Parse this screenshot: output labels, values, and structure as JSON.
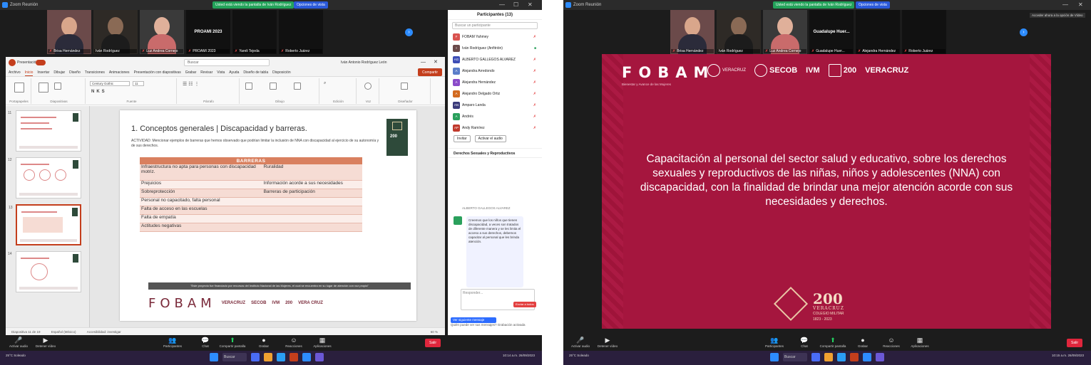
{
  "left": {
    "title": "Zoom Reunión",
    "share_banner": "Usted está viendo la pantalla de Iván Rodríguez",
    "share_options": "Opciones de vista",
    "participants": [
      {
        "name": "Brisa Hernández",
        "color": "#6b4a4a",
        "skin": "#d9a68b",
        "shirt": "#2b2b3a"
      },
      {
        "name": "Iván Rodríguez",
        "color": "#2e2a26",
        "skin": "#8a6a55",
        "shirt": "#1c1c1c"
      },
      {
        "name": "Luz Andrea Cornejo",
        "color": "#3a3a3a",
        "skin": "#e0b09a",
        "shirt": "#c96b6b"
      },
      {
        "name": "PROAMI 2023",
        "color": "#111111"
      },
      {
        "name": "Yareli Tejeda",
        "color": "#111111"
      },
      {
        "name": "Roberto Juárez",
        "color": "#111111"
      }
    ],
    "ppt": {
      "app_title": "Presentación",
      "search": "Buscar",
      "user": "Iván Antonio Rodríguez León",
      "menu": [
        "Archivo",
        "Inicio",
        "Insertar",
        "Dibujar",
        "Diseño",
        "Transiciones",
        "Animaciones",
        "Presentación con diapositivas",
        "Grabar",
        "Revisar",
        "Vista",
        "Ayuda",
        "Diseño de tabla",
        "Disposición"
      ],
      "grabar": "Grabar",
      "compartir": "Compartir",
      "ribbon_groups": [
        "Portapapeles",
        "Diapositivas",
        "Fuente",
        "Párrafo",
        "Dibujo",
        "Edición",
        "Voz",
        "Diseñador"
      ],
      "font_name": "Century Gothic",
      "font_size": "11",
      "slide_title": "1. Conceptos generales | Discapacidad y barreras.",
      "activity": "ACTIVIDAD: Mencionar ejemplos de barreras que hemos observado que podrían limitar la inclusión de NNA con discapacidad al ejercicio de su autonomía y de sus derechos.",
      "table_header": "BARRERAS",
      "table_rows": [
        [
          "Infraestructura no apta para personas con discapacidad motriz.",
          "Ruralidad"
        ],
        [
          "Prejuicios",
          "Información acorde a sus necesidades"
        ],
        [
          "Sobreprotección",
          "Barreras de participación"
        ],
        [
          "Personal no capacitado, falta personal",
          ""
        ],
        [
          "Falta de acceso en las escuelas",
          ""
        ],
        [
          "Falta de empatía",
          ""
        ],
        [
          "Actitudes negativas",
          ""
        ]
      ],
      "quote": "\"Este proyecto fue financiado por recursos del Instituto Nacional de las Mujeres, el cual se encuentra en su lugar de atención con voz propia\"",
      "fobam": "FOBAM",
      "logo_texts": [
        "VERACRUZ",
        "SECOB",
        "IVM",
        "200",
        "VERA CRUZ"
      ],
      "slide_count_label": "Diapositiva 11 de 19",
      "status_lang": "Español (México)",
      "status_access": "Accesibilidad: investigar",
      "zoom_level": "60 %",
      "thumb_numbers": [
        "11",
        "12",
        "13",
        "14"
      ]
    },
    "panel": {
      "title": "Participantes (13)",
      "search": "Buscar un participante",
      "people": [
        {
          "initials": "F",
          "name": "FOBAM Yahmey",
          "color": "#d9534f"
        },
        {
          "initials": "I",
          "name": "Iván Rodríguez (Anfitrión)",
          "color": "#6b4a4a"
        },
        {
          "initials": "AG",
          "name": "ALBERTO GALLEGOS ALVAREZ",
          "color": "#3d4db5"
        },
        {
          "initials": "A",
          "name": "Alejandra Arredondo",
          "color": "#5a7dc9"
        },
        {
          "initials": "A",
          "name": "Alejandra Hernández",
          "color": "#8a4ac9"
        },
        {
          "initials": "A",
          "name": "Alejandro Delgado Ortiz",
          "color": "#d26a1f"
        },
        {
          "initials": "AN",
          "name": "Amparo Landa",
          "color": "#3a3a7a"
        },
        {
          "initials": "A",
          "name": "Andrés",
          "color": "#2aa05c"
        },
        {
          "initials": "AP",
          "name": "Andy Ramírez",
          "color": "#c0392b"
        }
      ],
      "invite": "Invitar",
      "mute_all": "Activar el audio",
      "chat_title": "Derechos Sexuales y Reproductivos",
      "chat_sender": "ALBERTO GALLEGOS ALVAREZ",
      "chat_message": "Creemos que los niños que tienen discapacidad, a veces son tratados de diferente manera y se les limita el acceso a sus derechos, debemos capacitar al personal que les brinda atención.",
      "chat_input": "Responder...",
      "chat_send_btn": "Enviar a todos",
      "chat_blue": "Ver siguiente mensaje",
      "chat_footer": "Quién puede ver sus mensajes? Grabación activada"
    },
    "toolbar": [
      "Activar audio",
      "Detener vídeo",
      "Participantes",
      "Chat",
      "Compartir pantalla",
      "Grabar",
      "Reacciones",
      "Aplicaciones"
    ],
    "end": "Salir",
    "weather": "25°C Soleado",
    "search": "Buscar",
    "clock": "10:14 a.m. 26/09/2023"
  },
  "right": {
    "title": "Zoom Reunión",
    "share_banner": "Usted está viendo la pantalla de Iván Rodríguez",
    "share_options": "Opciones de vista",
    "side_note": "Acceder ahora a la opción de Vídeo",
    "participants": [
      {
        "name": "Brisa Hernández",
        "color": "#6b4a4a",
        "skin": "#d9a68b",
        "shirt": "#2b2b3a"
      },
      {
        "name": "Iván Rodríguez",
        "color": "#2e2a26",
        "skin": "#8a6a55",
        "shirt": "#1c1c1c"
      },
      {
        "name": "Luz Andrea Cornejo",
        "color": "#3a3a3a",
        "skin": "#e0b09a",
        "shirt": "#c96b6b"
      },
      {
        "name": "Guadalupe Huer...",
        "color": "#111111"
      },
      {
        "name": "Alejandra Hernández",
        "color": "#111111"
      },
      {
        "name": "Roberto Juárez",
        "color": "#111111"
      }
    ],
    "slide": {
      "fobam": "FOBAM",
      "subtitle": "Bienestar y Avance de las Mujeres",
      "logos": [
        "VERACRUZ",
        "SECOB",
        "IVM",
        "200",
        "VERACRUZ"
      ],
      "text": "Capacitación al personal del sector salud y educativo, sobre los derechos sexuales y reproductivos de las niñas, niños y adolescentes (NNA) con discapacidad, con la finalidad de brindar una mejor atención acorde con sus necesidades y derechos.",
      "emblem_200": "200",
      "emblem_place": "VERACRUZ",
      "emblem_college": "COLEGIO MILITAR",
      "emblem_years": "1823 - 2023"
    },
    "toolbar": [
      "Activar audio",
      "Detener vídeo",
      "Participantes",
      "Chat",
      "Compartir pantalla",
      "Grabar",
      "Reacciones",
      "Aplicaciones"
    ],
    "end": "Salir",
    "weather": "25°C Soleado",
    "search": "Buscar",
    "clock": "10:15 a.m. 26/09/2023"
  }
}
